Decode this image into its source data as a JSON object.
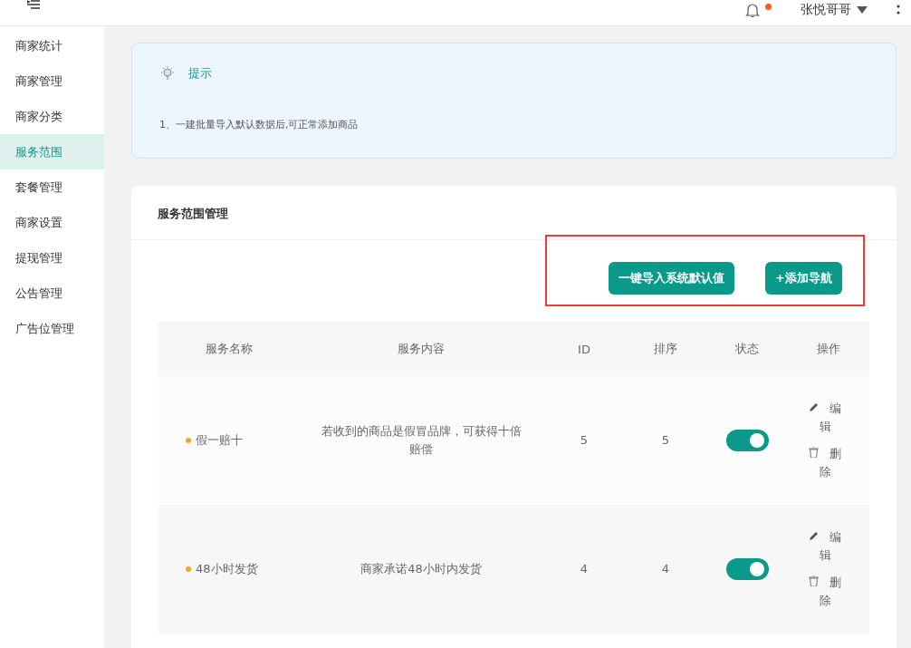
{
  "header": {
    "user": "张悦哥哥",
    "notification_dot": true
  },
  "sidebar": {
    "items": [
      {
        "label": "商家统计",
        "selected": false
      },
      {
        "label": "商家管理",
        "selected": false
      },
      {
        "label": "商家分类",
        "selected": false
      },
      {
        "label": "服务范围",
        "selected": true
      },
      {
        "label": "套餐管理",
        "selected": false
      },
      {
        "label": "商家设置",
        "selected": false
      },
      {
        "label": "提现管理",
        "selected": false
      },
      {
        "label": "公告管理",
        "selected": false
      },
      {
        "label": "广告位管理",
        "selected": false
      }
    ]
  },
  "tip": {
    "title": "提示",
    "text": "1、一建批量导入默认数据后,可正常添加商品"
  },
  "card": {
    "title": "服务范围管理",
    "buttons": [
      "一键导入系统默认值",
      "+添加导航"
    ]
  },
  "table": {
    "columns": [
      "服务名称",
      "服务内容",
      "ID",
      "排序",
      "状态",
      "操作"
    ],
    "rows": [
      {
        "name": "假一赔十",
        "content": "若收到的商品是假冒品牌，可获得十倍赔偿",
        "id": "5",
        "sort": "5",
        "on": true,
        "edit": "编辑",
        "delete": "删除"
      },
      {
        "name": "48小时发货",
        "content": "商家承诺48小时内发货",
        "id": "4",
        "sort": "4",
        "on": true,
        "edit": "编辑",
        "delete": "删除"
      }
    ]
  }
}
